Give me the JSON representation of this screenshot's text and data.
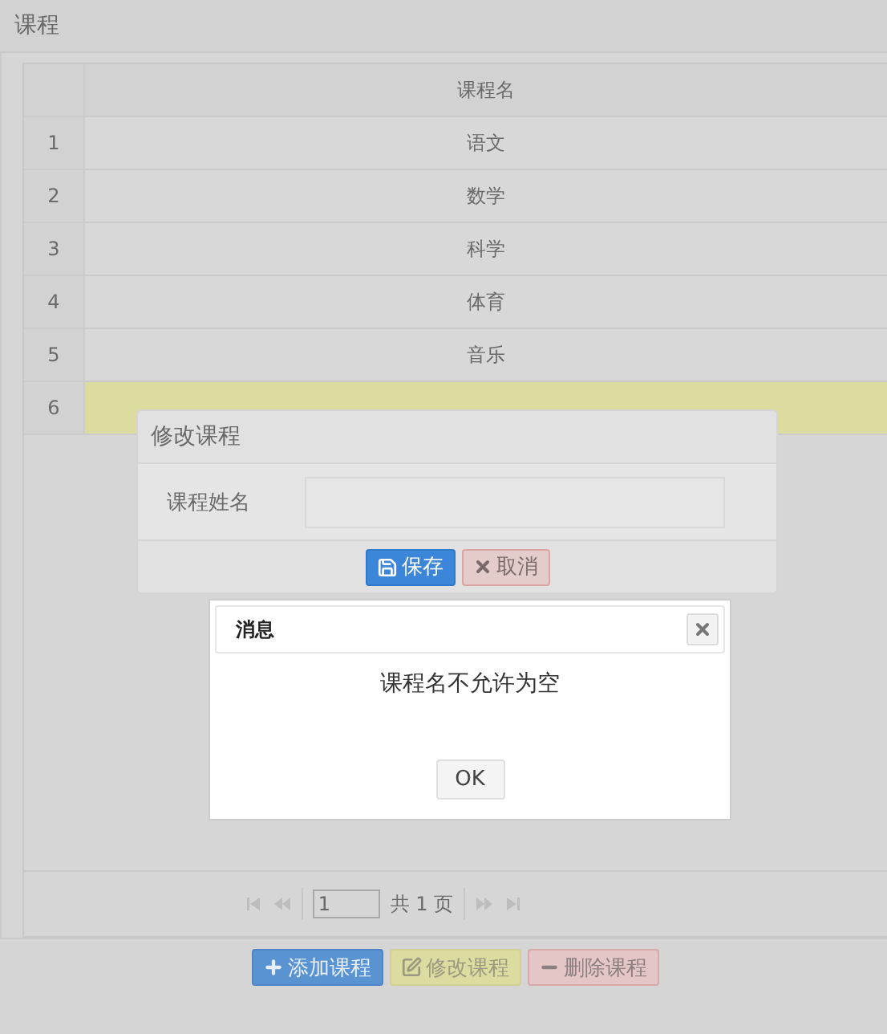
{
  "panel": {
    "title": "课程"
  },
  "table": {
    "columns": [
      "课程名"
    ],
    "rows": [
      {
        "index": "1",
        "name": "语文",
        "selected": false
      },
      {
        "index": "2",
        "name": "数学",
        "selected": false
      },
      {
        "index": "3",
        "name": "科学",
        "selected": false
      },
      {
        "index": "4",
        "name": "体育",
        "selected": false
      },
      {
        "index": "5",
        "name": "音乐",
        "selected": false
      },
      {
        "index": "6",
        "selected": true
      }
    ]
  },
  "pagination": {
    "page": "1",
    "total": "共 1 页"
  },
  "toolbar": [
    {
      "label": "添加课程",
      "kind": "add"
    },
    {
      "label": "修改课程",
      "kind": "edit"
    },
    {
      "label": "删除课程",
      "kind": "remove"
    }
  ],
  "edit_dialog": {
    "title": "修改课程",
    "field_label": "课程姓名",
    "buttons": [
      {
        "label": "保存",
        "kind": "save"
      },
      {
        "label": "取消",
        "kind": "cancel"
      }
    ]
  },
  "message_dialog": {
    "title": "消息",
    "text": "课程名不允许为空",
    "button": "OK"
  }
}
